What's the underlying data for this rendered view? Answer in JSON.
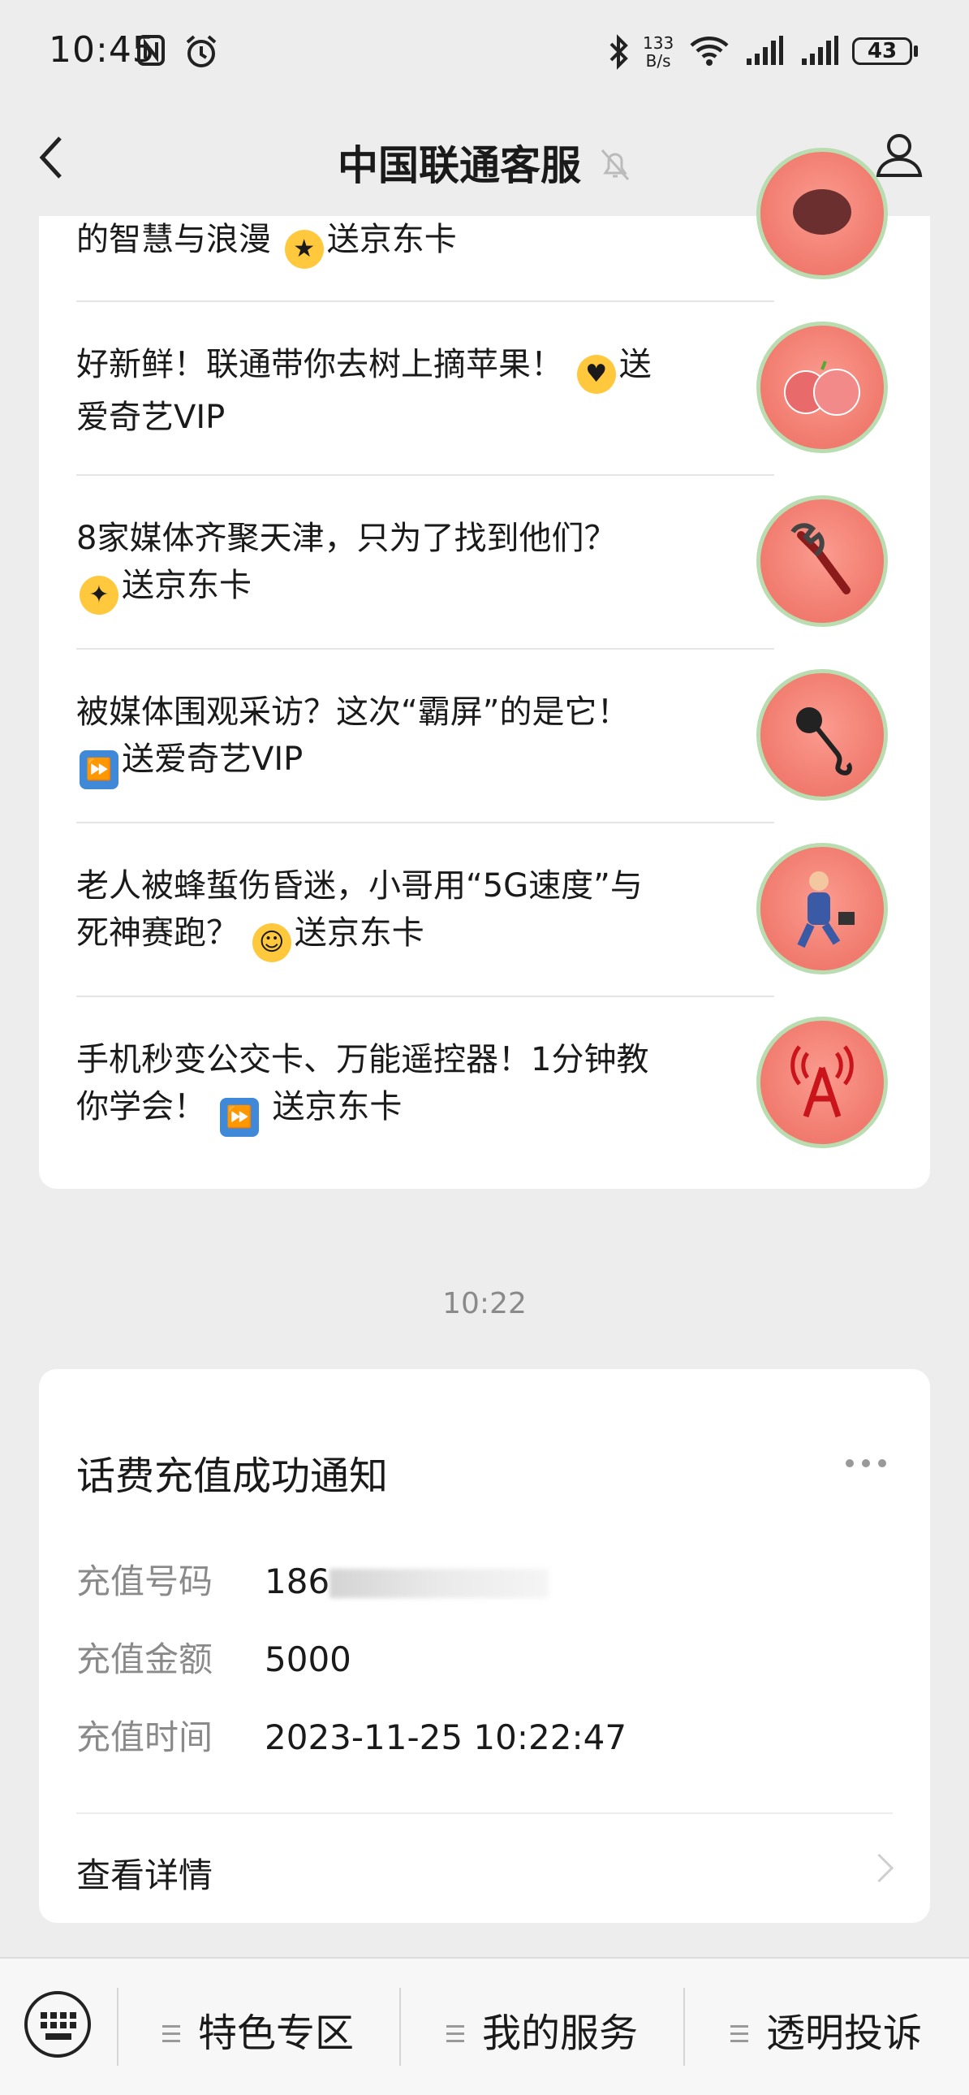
{
  "status_bar": {
    "time": "10:45",
    "net_speed_value": "133",
    "net_speed_unit": "B/s",
    "battery": "43"
  },
  "header": {
    "title": "中国联通客服"
  },
  "articles": [
    {
      "line1": "的智慧与浪漫",
      "emoji": "star-eyes-emoji",
      "tail": "送京东卡"
    },
    {
      "line1": "好新鲜！联通带你去树上摘苹果！",
      "emoji": "hearts-face-emoji",
      "tail": "送",
      "line2": "爱奇艺VIP",
      "thumb": "apples-thumbnail"
    },
    {
      "line1": "8家媒体齐聚天津，只为了找到他们？",
      "emoji": "party-face-emoji",
      "line2": "送京东卡",
      "thumb": "wrench-thumbnail"
    },
    {
      "line1": "被媒体围观采访？这次“霸屏”的是它！",
      "emoji": "fast-forward-emoji",
      "line2": "送爱奇艺VIP",
      "thumb": "microphone-thumbnail"
    },
    {
      "line1": "老人被蜂蜇伤昏迷，小哥用“5G速度”与",
      "line2": "死神赛跑？",
      "emoji": "hug-face-emoji",
      "tail": "送京东卡",
      "thumb": "worker-thumbnail"
    },
    {
      "line1": "手机秒变公交卡、万能遥控器！1分钟教",
      "line2": "你学会！",
      "emoji": "fast-forward-emoji",
      "tail": "送京东卡",
      "thumb": "signal-tower-thumbnail"
    }
  ],
  "timestamp": "10:22",
  "notice": {
    "title": "话费充值成功通知",
    "rows": [
      {
        "label": "充值号码",
        "value": "186"
      },
      {
        "label": "充值金额",
        "value": "5000"
      },
      {
        "label": "充值时间",
        "value": "2023-11-25 10:22:47"
      }
    ],
    "details_label": "查看详情"
  },
  "bottom_menu": [
    "特色专区",
    "我的服务",
    "透明投诉"
  ]
}
